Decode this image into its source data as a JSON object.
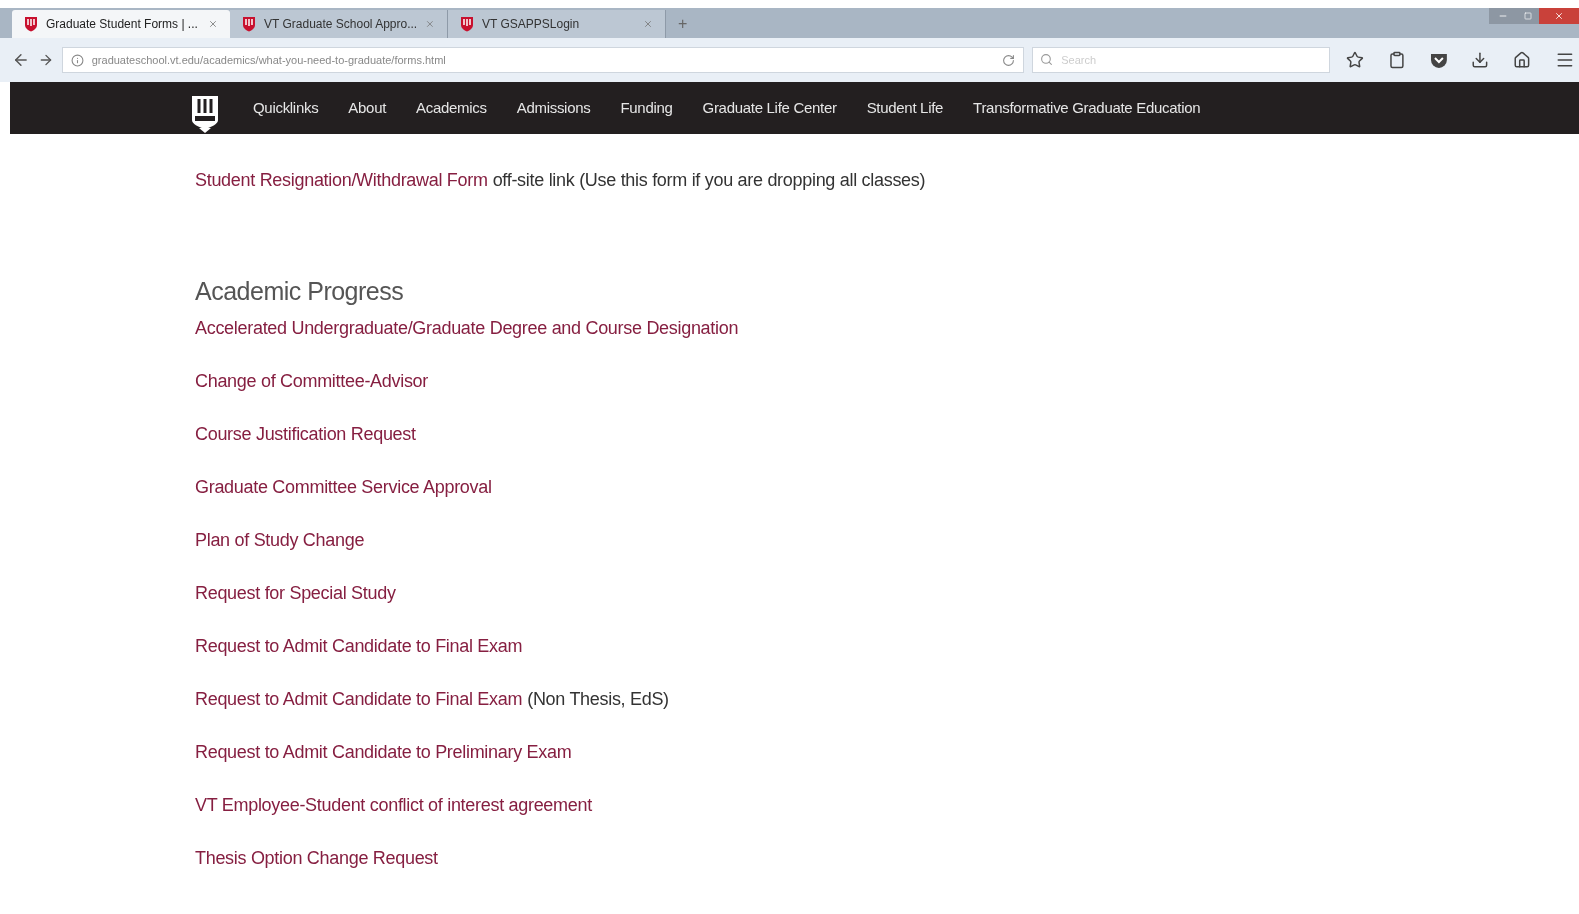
{
  "tabs": [
    {
      "title": "Graduate Student Forms | ...",
      "selected": true
    },
    {
      "title": "VT Graduate School Appro...",
      "selected": false
    },
    {
      "title": "VT GSAPPSLogin",
      "selected": false
    }
  ],
  "new_tab": "+",
  "address_bar": {
    "url": "graduateschool.vt.edu/academics/what-you-need-to-graduate/forms.html"
  },
  "search": {
    "placeholder": "Search"
  },
  "nav": {
    "items": [
      "Quicklinks",
      "About",
      "Academics",
      "Admissions",
      "Funding",
      "Graduate Life Center",
      "Student Life",
      "Transformative Graduate Education"
    ]
  },
  "intro_item": {
    "link": "Student Resignation/Withdrawal Form",
    "note": "off-site link (Use this form if you are dropping all classes)"
  },
  "section": {
    "heading": "Academic Progress",
    "items": [
      {
        "link": "Accelerated Undergraduate/Graduate Degree and Course Designation"
      },
      {
        "link": "Change of Committee-Advisor"
      },
      {
        "link": "Course Justification Request"
      },
      {
        "link": "Graduate Committee Service Approval"
      },
      {
        "link": "Plan of Study Change"
      },
      {
        "link": "Request for Special Study"
      },
      {
        "link": "Request to Admit Candidate to Final Exam"
      },
      {
        "link": "Request to Admit Candidate to Final Exam",
        "note": "(Non Thesis, EdS)"
      },
      {
        "link": "Request to Admit Candidate to Preliminary Exam"
      },
      {
        "link": "VT Employee-Student conflict of interest agreement"
      },
      {
        "link": "Thesis Option Change Request"
      }
    ]
  }
}
